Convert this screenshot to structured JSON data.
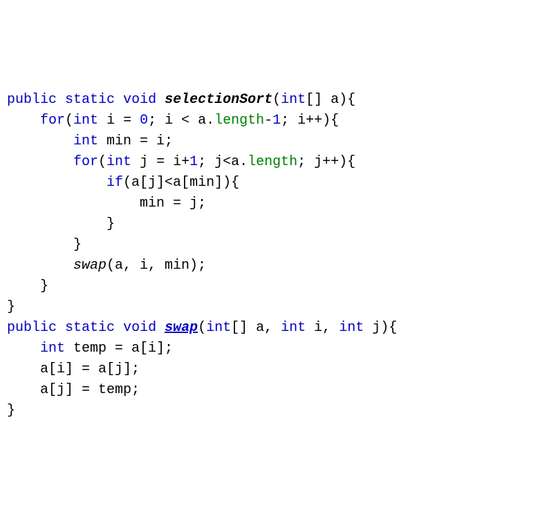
{
  "code": {
    "lines": [
      {
        "id": "l1",
        "parts": [
          {
            "t": "public",
            "c": "kw"
          },
          {
            "t": " "
          },
          {
            "t": "static",
            "c": "kw"
          },
          {
            "t": " "
          },
          {
            "t": "void",
            "c": "kw"
          },
          {
            "t": " "
          },
          {
            "t": "selectionSort",
            "c": "method-name"
          },
          {
            "t": "("
          },
          {
            "t": "int",
            "c": "kw"
          },
          {
            "t": "[] a){"
          }
        ]
      },
      {
        "id": "l2",
        "parts": [
          {
            "t": "    "
          },
          {
            "t": "for",
            "c": "kw"
          },
          {
            "t": "("
          },
          {
            "t": "int",
            "c": "kw"
          },
          {
            "t": " i = "
          },
          {
            "t": "0",
            "c": "num"
          },
          {
            "t": "; i < a."
          },
          {
            "t": "length",
            "c": "prop"
          },
          {
            "t": "-"
          },
          {
            "t": "1",
            "c": "num"
          },
          {
            "t": "; i++){"
          }
        ]
      },
      {
        "id": "l3",
        "parts": [
          {
            "t": "        "
          },
          {
            "t": "int",
            "c": "kw"
          },
          {
            "t": " min = i;"
          }
        ]
      },
      {
        "id": "l4",
        "parts": [
          {
            "t": "        "
          },
          {
            "t": "for",
            "c": "kw"
          },
          {
            "t": "("
          },
          {
            "t": "int",
            "c": "kw"
          },
          {
            "t": " j = i+"
          },
          {
            "t": "1",
            "c": "num"
          },
          {
            "t": "; j<a."
          },
          {
            "t": "length",
            "c": "prop"
          },
          {
            "t": "; j++){"
          }
        ]
      },
      {
        "id": "l5",
        "parts": [
          {
            "t": "            "
          },
          {
            "t": "if",
            "c": "kw"
          },
          {
            "t": "(a[j]<a[min]){"
          }
        ]
      },
      {
        "id": "l6",
        "parts": [
          {
            "t": "                min = j;"
          }
        ]
      },
      {
        "id": "l7",
        "parts": [
          {
            "t": "            }"
          }
        ]
      },
      {
        "id": "l8",
        "parts": [
          {
            "t": "        }"
          }
        ]
      },
      {
        "id": "l9",
        "parts": [
          {
            "t": "        "
          },
          {
            "t": "swap",
            "c": "call-italic"
          },
          {
            "t": "(a, i, min);"
          }
        ]
      },
      {
        "id": "l10",
        "parts": [
          {
            "t": "    }"
          }
        ]
      },
      {
        "id": "l11",
        "parts": [
          {
            "t": "}"
          }
        ]
      },
      {
        "id": "l12",
        "parts": [
          {
            "t": "public",
            "c": "kw"
          },
          {
            "t": " "
          },
          {
            "t": "static",
            "c": "kw"
          },
          {
            "t": " "
          },
          {
            "t": "void",
            "c": "kw"
          },
          {
            "t": " "
          },
          {
            "t": "swap",
            "c": "swap-name"
          },
          {
            "t": "("
          },
          {
            "t": "int",
            "c": "kw"
          },
          {
            "t": "[] a, "
          },
          {
            "t": "int",
            "c": "kw"
          },
          {
            "t": " i, "
          },
          {
            "t": "int",
            "c": "kw"
          },
          {
            "t": " j){"
          }
        ]
      },
      {
        "id": "l13",
        "parts": [
          {
            "t": "    "
          },
          {
            "t": "int",
            "c": "kw"
          },
          {
            "t": " temp = a[i];"
          }
        ]
      },
      {
        "id": "l14",
        "parts": [
          {
            "t": "    a[i] = a[j];"
          }
        ]
      },
      {
        "id": "l15",
        "parts": [
          {
            "t": "    a[j] = temp;"
          }
        ]
      },
      {
        "id": "l16",
        "parts": [
          {
            "t": "}"
          }
        ]
      }
    ]
  }
}
